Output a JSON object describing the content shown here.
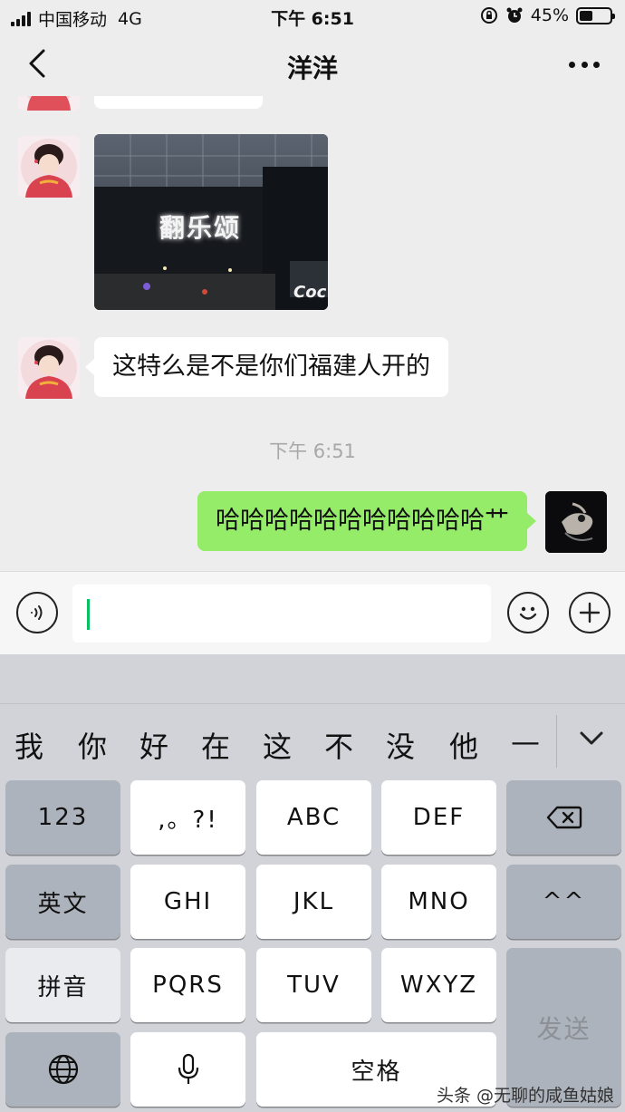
{
  "status_bar": {
    "carrier": "中国移动",
    "network": "4G",
    "time": "下午 6:51",
    "battery_percent": "45%",
    "battery_level": 0.45
  },
  "nav": {
    "title": "洋洋"
  },
  "chat": {
    "image_sign_text": "翻乐颂",
    "image_shop_text": "Coc",
    "message_left": "这特么是不是你们福建人开的",
    "timestamp": "下午 6:51",
    "message_right": "哈哈哈哈哈哈哈哈哈哈哈艹"
  },
  "keyboard": {
    "candidates": [
      "我",
      "你",
      "好",
      "在",
      "这",
      "不",
      "没",
      "他",
      "—"
    ],
    "keys": {
      "num": "123",
      "punct": ",。?!",
      "abc": "ABC",
      "def": "DEF",
      "english": "英文",
      "ghi": "GHI",
      "jkl": "JKL",
      "mno": "MNO",
      "emoticon": "^^",
      "pinyin": "拼音",
      "pqrs": "PQRS",
      "tuv": "TUV",
      "wxyz": "WXYZ",
      "send": "发送",
      "space": "空格"
    }
  },
  "watermark": "头条 @无聊的咸鱼姑娘"
}
